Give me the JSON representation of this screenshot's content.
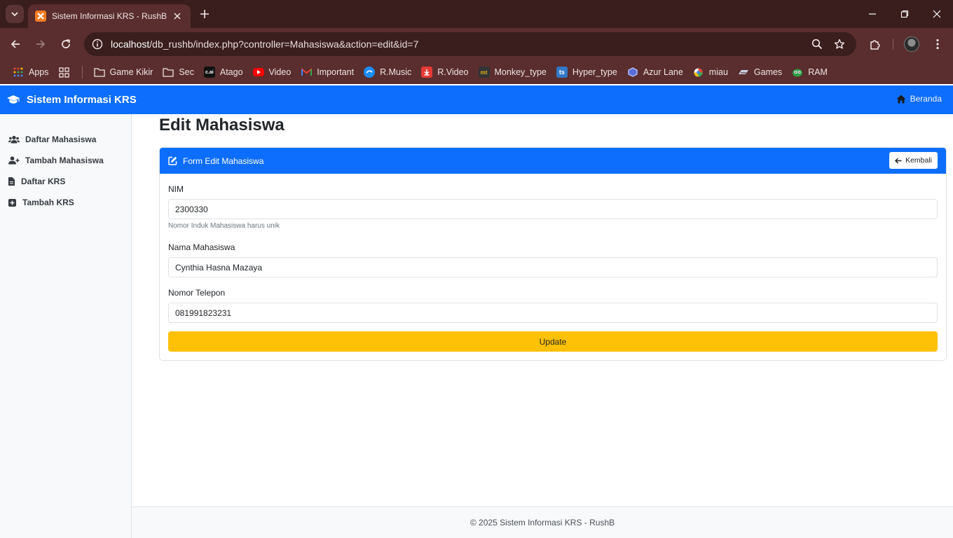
{
  "browser": {
    "tab_title": "Sistem Informasi KRS - RushB",
    "url_host": "localhost",
    "url_rest": "/db_rushb/index.php?controller=Mahasiswa&action=edit&id=7",
    "bookmarks": [
      {
        "label": "Apps",
        "icon": "apps-grid-icon"
      },
      {
        "label": "Game Kikir",
        "icon": "folder-icon"
      },
      {
        "label": "Sec",
        "icon": "folder-icon"
      },
      {
        "label": "Atago",
        "icon": "cai-icon"
      },
      {
        "label": "Video",
        "icon": "youtube-icon"
      },
      {
        "label": "Important",
        "icon": "gmail-icon"
      },
      {
        "label": "R.Music",
        "icon": "music-icon"
      },
      {
        "label": "R.Video",
        "icon": "download-icon"
      },
      {
        "label": "Monkey_type",
        "icon": "monkeytype-icon"
      },
      {
        "label": "Hyper_type",
        "icon": "ts-icon"
      },
      {
        "label": "Azur Lane",
        "icon": "azurlane-icon"
      },
      {
        "label": "miau",
        "icon": "miau-icon"
      },
      {
        "label": "Games",
        "icon": "games-icon"
      },
      {
        "label": "RAM",
        "icon": "ram-icon"
      }
    ]
  },
  "navbar": {
    "brand": "Sistem Informasi KRS",
    "home_link": "Beranda"
  },
  "sidebar": {
    "items": [
      {
        "label": "Daftar Mahasiswa",
        "icon": "users-icon"
      },
      {
        "label": "Tambah Mahasiswa",
        "icon": "user-plus-icon"
      },
      {
        "label": "Daftar KRS",
        "icon": "file-icon"
      },
      {
        "label": "Tambah KRS",
        "icon": "plus-square-icon"
      }
    ]
  },
  "main": {
    "page_title": "Edit Mahasiswa",
    "card_title": "Form Edit Mahasiswa",
    "back_button": "Kembali",
    "fields": {
      "nim_label": "NIM",
      "nim_value": "2300330",
      "nim_help": "Nomor Induk Mahasiswa harus unik",
      "nama_label": "Nama Mahasiswa",
      "nama_value": "Cynthia Hasna Mazaya",
      "telepon_label": "Nomor Telepon",
      "telepon_value": "081991823231"
    },
    "submit_button": "Update"
  },
  "footer": {
    "text": "© 2025 Sistem Informasi KRS - RushB"
  },
  "colors": {
    "primary": "#0d6efd",
    "warning": "#ffc107",
    "browser_frame": "#5a2e2e"
  }
}
